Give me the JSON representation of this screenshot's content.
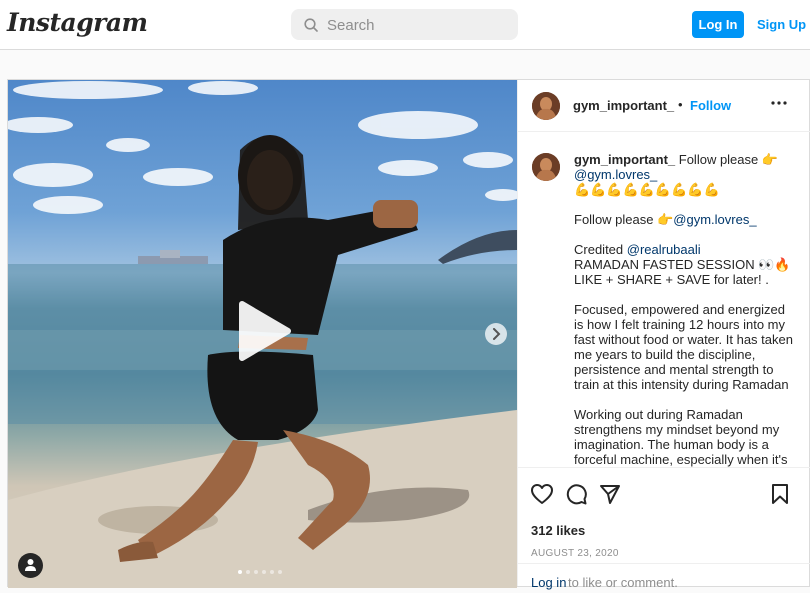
{
  "header": {
    "logo": "Instagram",
    "search_placeholder": "Search",
    "login_label": "Log In",
    "signup_label": "Sign Up"
  },
  "post": {
    "username": "gym_important_",
    "separator": "•",
    "follow_label": "Follow",
    "media": {
      "carousel_slides": 6,
      "active_slide": 1
    },
    "caption": {
      "line1": "Follow please 👉",
      "mention1": "@gym.lovres_",
      "emoji_row": "💪💪💪💪💪💪💪💪💪",
      "para2_text": "Follow please 👉",
      "para2_mention": "@gym.lovres_",
      "para3_prefix": "Credited ",
      "para3_mention": "@realrubaali",
      "para3_rest": "RAMADAN FASTED SESSION 👀🔥 LIKE + SHARE + SAVE for later! .",
      "para4": "Focused, empowered and energized is how I felt training 12 hours into my fast without food or water. It has taken me years to build the discipline, persistence and mental strength to train at this intensity during Ramadan",
      "para5": "Working out during Ramadan strengthens my mindset beyond my imagination. The human body is a forceful machine, especially when it's"
    },
    "likes": "312 likes",
    "date": "AUGUST 23, 2020",
    "login_link": "Log in",
    "login_rest": "to like or comment."
  },
  "icons": [
    "search-icon",
    "play-icon",
    "chevron-right-icon",
    "user-tag-icon",
    "more-icon",
    "heart-icon",
    "comment-icon",
    "share-icon",
    "bookmark-icon"
  ]
}
